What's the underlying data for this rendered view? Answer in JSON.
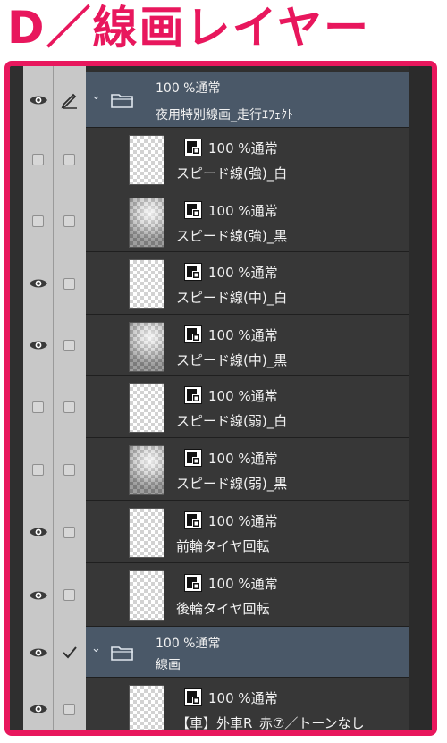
{
  "header": {
    "title": "D／線画レイヤー"
  },
  "colors": {
    "accent": "#e8175d",
    "folder_bg": "#4a5868",
    "row_bg": "#373737",
    "panel_bg": "#2f2f2f"
  },
  "icons": {
    "visible": "eye-icon",
    "hidden": "checkbox-icon",
    "edit": "pen-icon",
    "check": "check-icon",
    "folder": "folder-icon",
    "layer": "raster-layer-icon"
  },
  "layers": [
    {
      "type": "folder",
      "mode": "100 %通常",
      "name": "夜用特別線画_走行ｴﾌｪｸﾄ",
      "visible": true,
      "lock": "pen"
    },
    {
      "type": "layer",
      "mode": "100 %通常",
      "name": "スピード線(強)_白",
      "visible": false,
      "thumb": "light"
    },
    {
      "type": "layer",
      "mode": "100 %通常",
      "name": "スピード線(強)_黒",
      "visible": false,
      "thumb": "dark"
    },
    {
      "type": "layer",
      "mode": "100 %通常",
      "name": "スピード線(中)_白",
      "visible": true,
      "thumb": "light"
    },
    {
      "type": "layer",
      "mode": "100 %通常",
      "name": "スピード線(中)_黒",
      "visible": true,
      "thumb": "dark"
    },
    {
      "type": "layer",
      "mode": "100 %通常",
      "name": "スピード線(弱)_白",
      "visible": false,
      "thumb": "light"
    },
    {
      "type": "layer",
      "mode": "100 %通常",
      "name": "スピード線(弱)_黒",
      "visible": false,
      "thumb": "dark"
    },
    {
      "type": "layer",
      "mode": "100 %通常",
      "name": "前輪タイヤ回転",
      "visible": true,
      "thumb": "light"
    },
    {
      "type": "layer",
      "mode": "100 %通常",
      "name": "後輪タイヤ回転",
      "visible": true,
      "thumb": "light"
    },
    {
      "type": "folder",
      "mode": "100 %通常",
      "name": "線画",
      "visible": true,
      "lock": "check"
    },
    {
      "type": "layer",
      "mode": "100 %通常",
      "name": "【車】外車R_赤⑦／トーンなし",
      "visible": true,
      "thumb": "light"
    }
  ]
}
